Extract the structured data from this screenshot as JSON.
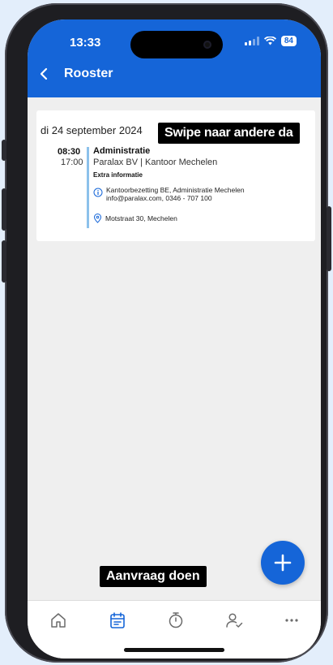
{
  "status_bar": {
    "time": "13:33",
    "battery": "84"
  },
  "appbar": {
    "title": "Rooster"
  },
  "schedule": {
    "date_label": "di 24 september 2024",
    "shift": {
      "start": "08:30",
      "end": "17:00",
      "title": "Administratie",
      "location": "Paralax BV | Kantoor Mechelen",
      "extra_label": "Extra informatie",
      "info_line1": "Kantoorbezetting BE, Administratie Mechelen",
      "info_line2": "info@paralax.com, 0346 - 707 100",
      "address": "Motstraat 30, Mechelen"
    }
  },
  "tooltips": {
    "swipe": "Swipe naar andere da",
    "aanvraag": "Aanvraag doen"
  },
  "nav": {
    "items": [
      "home-icon",
      "calendar-icon",
      "stopwatch-icon",
      "user-check-icon",
      "more-icon"
    ],
    "active_index": 1
  },
  "colors": {
    "primary": "#1565d8",
    "accent_bar": "#8cc1eb",
    "background": "#efefef"
  }
}
